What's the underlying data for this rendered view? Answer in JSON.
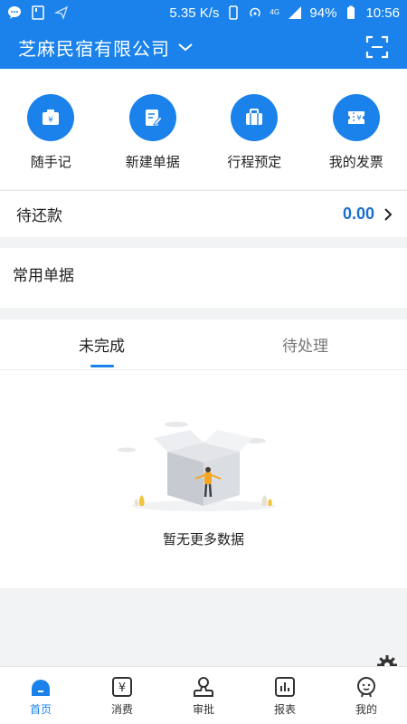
{
  "status_bar": {
    "speed": "5.35 K/s",
    "battery": "94%",
    "time": "10:56",
    "net": "4G"
  },
  "header": {
    "company": "芝麻民宿有限公司"
  },
  "quick_actions": [
    {
      "label": "随手记",
      "icon": "wallet-yen-icon"
    },
    {
      "label": "新建单据",
      "icon": "edit-doc-icon"
    },
    {
      "label": "行程预定",
      "icon": "suitcase-icon"
    },
    {
      "label": "我的发票",
      "icon": "invoice-icon"
    }
  ],
  "repay": {
    "label": "待还款",
    "amount": "0.00"
  },
  "common_docs": {
    "label": "常用单据"
  },
  "tabs": [
    {
      "label": "未完成",
      "active": true
    },
    {
      "label": "待处理",
      "active": false
    }
  ],
  "empty": {
    "message": "暂无更多数据"
  },
  "bottom_nav": [
    {
      "label": "首页",
      "icon": "home-icon",
      "active": true
    },
    {
      "label": "消费",
      "icon": "yen-icon",
      "active": false
    },
    {
      "label": "审批",
      "icon": "approve-icon",
      "active": false
    },
    {
      "label": "报表",
      "icon": "report-icon",
      "active": false
    },
    {
      "label": "我的",
      "icon": "profile-icon",
      "active": false
    }
  ],
  "colors": {
    "primary": "#1a82ea",
    "amount": "#1a6fd0"
  }
}
